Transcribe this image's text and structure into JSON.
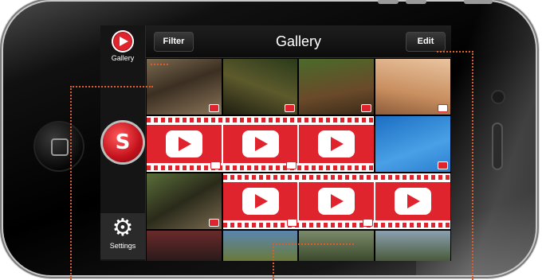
{
  "sidebar": {
    "gallery_label": "Gallery",
    "settings_label": "Settings"
  },
  "topbar": {
    "title": "Gallery",
    "filter_label": "Filter",
    "edit_label": "Edit"
  },
  "grid": {
    "rows": [
      [
        "photo",
        "photo",
        "photo",
        "photo"
      ],
      [
        "video",
        "video",
        "video",
        "photo"
      ],
      [
        "photo",
        "video",
        "video",
        "video"
      ],
      [
        "photo",
        "photo",
        "photo",
        "photo"
      ]
    ]
  },
  "colors": {
    "accent": "#e0242d",
    "annotation": "#e05a2a",
    "background": "#000000"
  }
}
